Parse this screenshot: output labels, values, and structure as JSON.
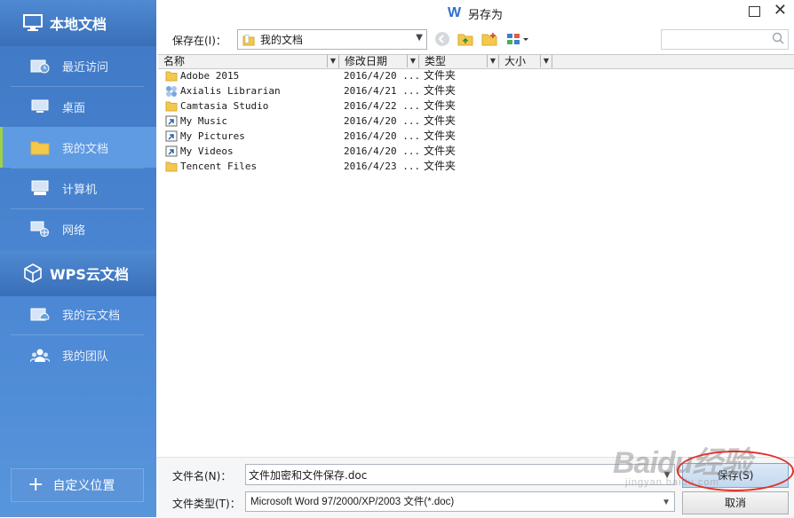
{
  "sidebar": {
    "local_section": {
      "title": "本地文档",
      "icon": "monitor-icon"
    },
    "local_items": [
      {
        "label": "最近访问",
        "icon": "recent-folder-icon"
      },
      {
        "label": "桌面",
        "icon": "desktop-icon"
      },
      {
        "label": "我的文档",
        "icon": "folder-icon",
        "active": true
      },
      {
        "label": "计算机",
        "icon": "computer-icon"
      },
      {
        "label": "网络",
        "icon": "network-icon"
      }
    ],
    "cloud_section": {
      "title": "WPS云文档",
      "icon": "cube-icon"
    },
    "cloud_items": [
      {
        "label": "我的云文档",
        "icon": "cloud-folder-icon"
      },
      {
        "label": "我的团队",
        "icon": "team-icon"
      }
    ],
    "custom_location": "自定义位置"
  },
  "title": {
    "logo": "W",
    "text": "另存为"
  },
  "toolbar": {
    "save_in_label": "保存在(I)：",
    "save_in_value": "我的文档"
  },
  "columns": [
    "名称",
    "修改日期",
    "类型",
    "大小"
  ],
  "files": [
    {
      "name": "Adobe 2015",
      "date": "2016/4/20 ...",
      "type": "文件夹",
      "icon": "folder"
    },
    {
      "name": "Axialis Librarian",
      "date": "2016/4/21 ...",
      "type": "文件夹",
      "icon": "special"
    },
    {
      "name": "Camtasia Studio",
      "date": "2016/4/22 ...",
      "type": "文件夹",
      "icon": "folder"
    },
    {
      "name": "My Music",
      "date": "2016/4/20 ...",
      "type": "文件夹",
      "icon": "shortcut"
    },
    {
      "name": "My Pictures",
      "date": "2016/4/20 ...",
      "type": "文件夹",
      "icon": "shortcut"
    },
    {
      "name": "My Videos",
      "date": "2016/4/20 ...",
      "type": "文件夹",
      "icon": "shortcut"
    },
    {
      "name": "Tencent Files",
      "date": "2016/4/23 ...",
      "type": "文件夹",
      "icon": "folder"
    }
  ],
  "bottom": {
    "filename_label": "文件名(N)：",
    "filename_value": "文件加密和文件保存.doc",
    "filetype_label": "文件类型(T)：",
    "filetype_value": "Microsoft Word 97/2000/XP/2003 文件(*.doc)",
    "save_label": "保存(S)",
    "cancel_label": "取消"
  },
  "watermark": {
    "brand": "Baidu经验",
    "url": "jingyan.baidu.com"
  },
  "colors": {
    "sidebar": "#4c88d4",
    "active_item": "#5f9be2",
    "active_marker": "#9fd04a",
    "highlight": "#e0302a",
    "wps_blue": "#2f6fd0"
  }
}
